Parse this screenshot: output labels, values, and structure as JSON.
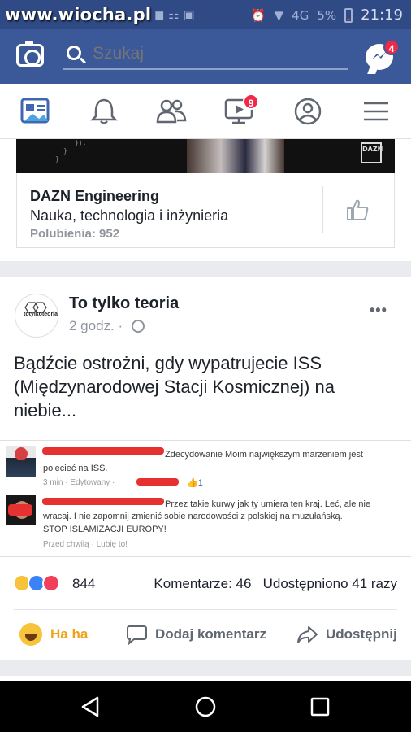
{
  "status_bar": {
    "watermark": "www.wiocha.pl",
    "network": "4G",
    "battery": "5%",
    "time": "21:19"
  },
  "topbar": {
    "search_placeholder": "Szukaj",
    "messenger_badge": "4",
    "brand_color": "#3b5998"
  },
  "navbar": {
    "video_badge": "9",
    "items": [
      "news-feed-icon",
      "notifications-bell-icon",
      "friends-icon",
      "video-icon",
      "profile-icon",
      "menu-icon"
    ]
  },
  "dazn_card": {
    "image_code": [
      "});",
      "}",
      "}"
    ],
    "logo": "DAZN",
    "name": "DAZN Engineering",
    "category": "Nauka, technologia i inżynieria",
    "likes": "Polubienia: 952"
  },
  "post": {
    "page_name": "To tylko teoria",
    "avatar_text": "totylkoteoria",
    "time": "2 godz.",
    "separator": "·",
    "text": "Bądźcie ostrożni, gdy wypatrujecie ISS (Międzynarodowej Stacji Kosmicznej) na niebie...",
    "screenshot": {
      "comment1_line1": "Zdecydowanie Moim największym marzeniem jest",
      "comment1_line2": "polecieć na ISS.",
      "comment1_meta": "3 min · Edytowany ·",
      "comment1_likes": "1",
      "comment2_line1": "Przez takie kurwy jak ty umiera ten kraj. Leć, ale nie",
      "comment2_line2": "wracaj. I nie zapomnij zmienić sobie narodowości z polskiej na muzułańską.",
      "comment2_line3": "STOP ISLAMIZACJI EUROPY!",
      "comment2_meta": "Przed chwilą · Lubię to!"
    },
    "reaction_count": "844",
    "comments": "Komentarze: 46",
    "shares": "Udostępniono 41 razy",
    "actions": {
      "react": "Ha ha",
      "comment": "Dodaj komentarz",
      "share": "Udostępnij"
    }
  }
}
